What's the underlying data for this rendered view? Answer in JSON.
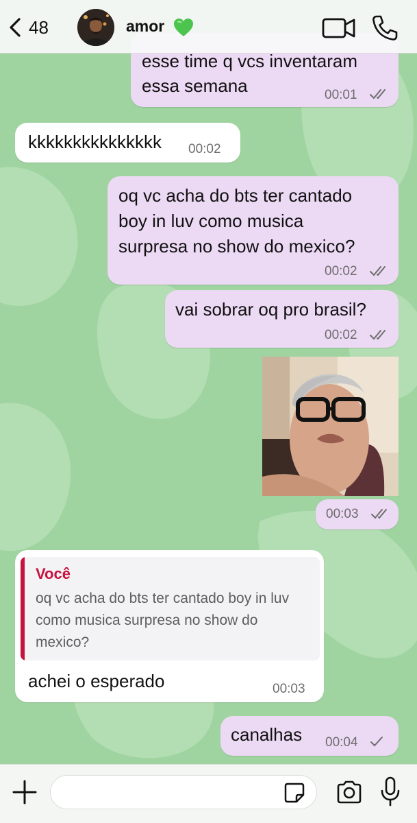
{
  "header": {
    "back_count": "48",
    "contact_name": "amor",
    "status_icons": [
      "green-heart-icon",
      "video-camera-icon",
      "phone-icon"
    ]
  },
  "messages": [
    {
      "direction": "outgoing",
      "lines": [
        "esse time q vcs inventaram",
        "essa semana"
      ],
      "time": "00:01",
      "status": "read"
    },
    {
      "direction": "incoming",
      "lines": [
        "kkkkkkkkkkkkkkk"
      ],
      "time": "00:02"
    },
    {
      "direction": "outgoing",
      "lines": [
        "oq vc acha do bts ter cantado",
        "boy in luv como musica",
        "surpresa no show do mexico?"
      ],
      "time": "00:02",
      "status": "read"
    },
    {
      "direction": "outgoing",
      "lines": [
        "vai sobrar oq pro brasil?"
      ],
      "time": "00:02",
      "status": "read"
    },
    {
      "direction": "outgoing",
      "type": "photo",
      "time": "00:03",
      "status": "read"
    },
    {
      "direction": "incoming",
      "quote": {
        "author": "Você",
        "text": "oq vc acha do bts ter cantado boy in luv como musica surpresa no show do mexico?"
      },
      "lines": [
        "achei o esperado"
      ],
      "time": "00:03"
    },
    {
      "direction": "outgoing",
      "lines": [
        "canalhas"
      ],
      "time": "00:04",
      "status": "sent"
    }
  ],
  "input": {
    "placeholder": "",
    "value": ""
  },
  "colors": {
    "chat_background": "#9fd4a1",
    "outgoing_bubble": "#ecd9f4",
    "incoming_bubble": "#ffffff",
    "quote_accent": "#c8113f",
    "read_ticks": "#6d6d6d"
  }
}
